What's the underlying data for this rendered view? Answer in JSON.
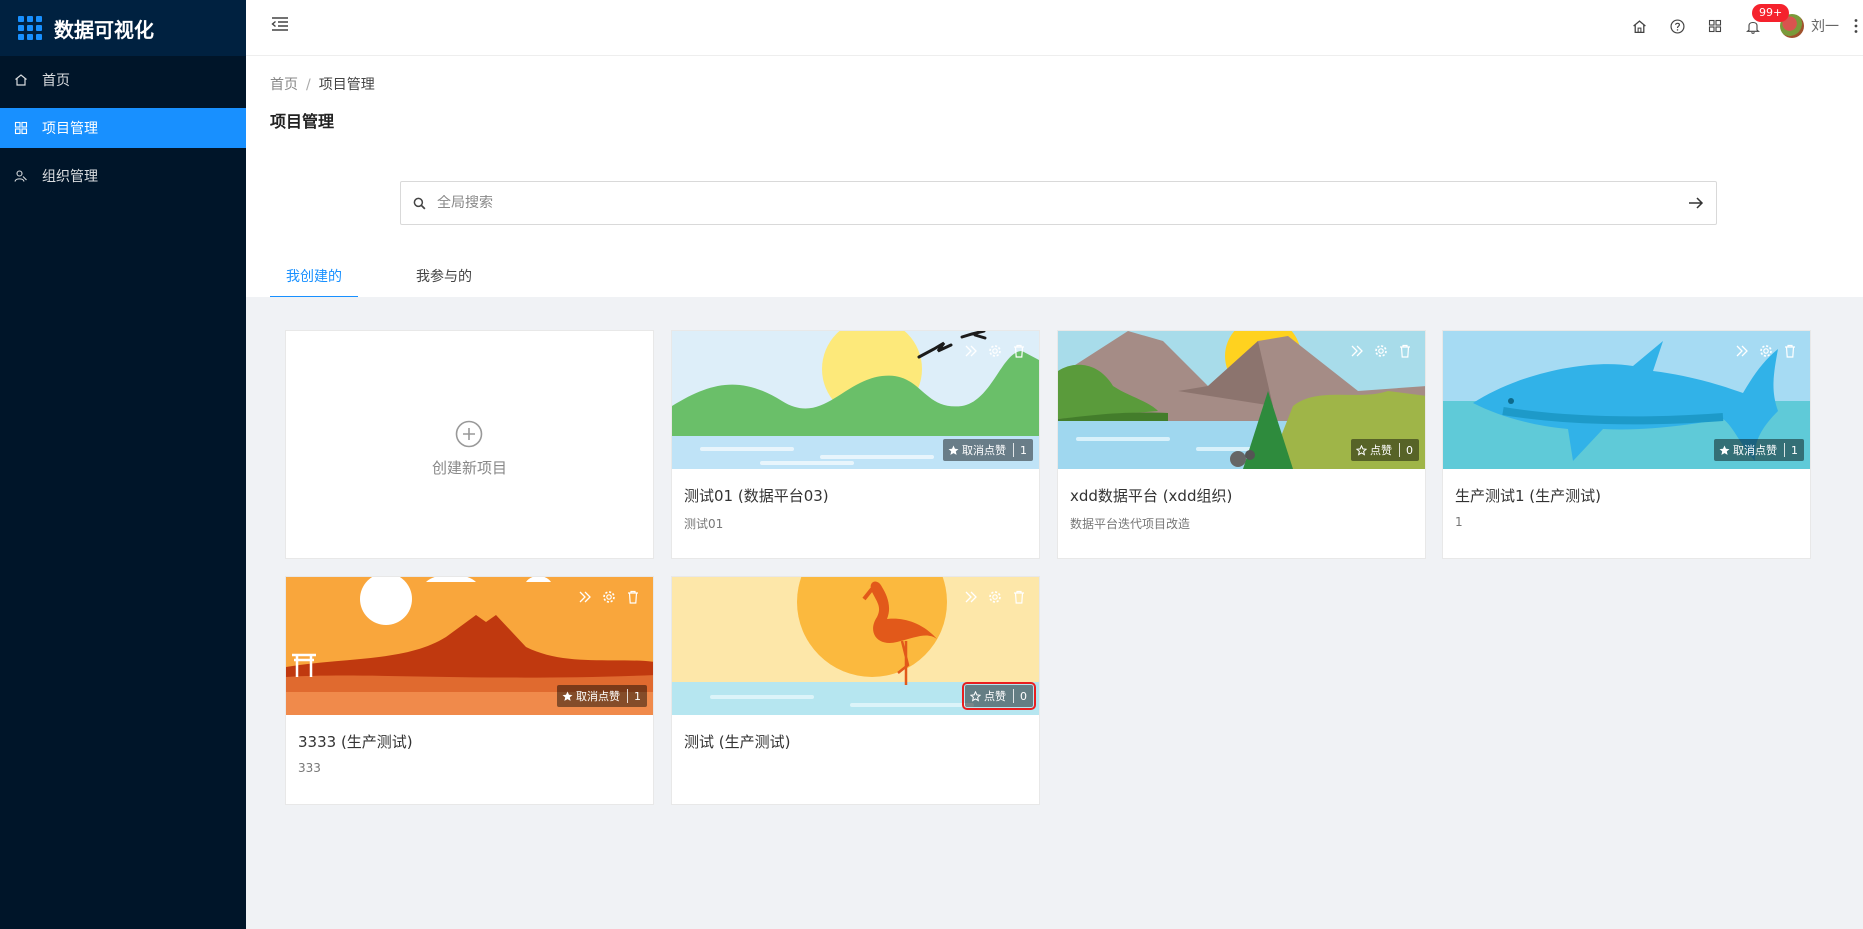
{
  "app": {
    "title": "数据可视化"
  },
  "sidebar": {
    "items": [
      {
        "label": "首页",
        "icon": "home-icon"
      },
      {
        "label": "项目管理",
        "icon": "grid-icon",
        "active": true
      },
      {
        "label": "组织管理",
        "icon": "team-icon"
      }
    ]
  },
  "header": {
    "notification_count": "99+",
    "username": "刘一",
    "icons": [
      "home-icon",
      "help-icon",
      "apps-icon",
      "bell-icon",
      "more-icon"
    ]
  },
  "breadcrumb": {
    "home": "首页",
    "separator": "/",
    "current": "项目管理"
  },
  "page": {
    "title": "项目管理"
  },
  "search": {
    "placeholder": "全局搜索",
    "value": ""
  },
  "tabs": [
    {
      "label": "我创建的",
      "active": true
    },
    {
      "label": "我参与的",
      "active": false
    }
  ],
  "new_project": {
    "label": "创建新项目"
  },
  "projects": [
    {
      "title": "测试01 (数据平台03)",
      "desc": "测试01",
      "like_label": "取消点赞",
      "like_count": "1",
      "liked": true,
      "theme": "sun-hills"
    },
    {
      "title": "xdd数据平台 (xdd组织)",
      "desc": "数据平台迭代项目改造",
      "like_label": "点赞",
      "like_count": "0",
      "liked": false,
      "theme": "mountain-lake"
    },
    {
      "title": "生产测试1 (生产测试)",
      "desc": "1",
      "like_label": "取消点赞",
      "like_count": "1",
      "liked": true,
      "theme": "shark"
    },
    {
      "title": "3333 (生产测试)",
      "desc": "333",
      "like_label": "取消点赞",
      "like_count": "1",
      "liked": true,
      "theme": "volcano-sunset"
    },
    {
      "title": "测试 (生产测试)",
      "desc": "",
      "like_label": "点赞",
      "like_count": "0",
      "liked": false,
      "theme": "flamingo"
    }
  ],
  "colors": {
    "brand": "#1890ff",
    "sidebar": "#001529",
    "badge": "#f5222d",
    "highlight": "#e81f1f"
  }
}
